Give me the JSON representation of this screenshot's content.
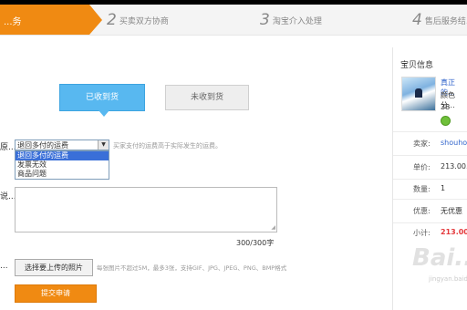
{
  "steps": {
    "active_label": "...务",
    "items": [
      {
        "num": "2",
        "label": "买卖双方协商"
      },
      {
        "num": "3",
        "label": "淘宝介入处理"
      },
      {
        "num": "4",
        "label": "售后服务结..."
      }
    ]
  },
  "receipt": {
    "received_label": "已收到货",
    "not_received_label": "未收到货"
  },
  "form": {
    "reason_label": "原...",
    "reason_selected": "退回多付的运费",
    "reason_options": [
      "退回多付的运费",
      "发票无效",
      "商品问题"
    ],
    "reason_hint": "买家支付的运费高于实际发生的运费。",
    "desc_label": "说...",
    "counter": "300/300字",
    "upload_label": "...",
    "upload_button": "选择要上传的照片",
    "upload_hint": "每张图片不超过5M，最多3张，支持GIF、JPG、JPEG、PNG、BMP格式",
    "submit_button": "提交申请"
  },
  "sidebar": {
    "title": "宝贝信息",
    "product_link": "真正的...",
    "product_color": "颜色分...",
    "product_size": "38",
    "rows": [
      {
        "key": "卖家:",
        "value": "shouho..."
      },
      {
        "key": "单价:",
        "value": "213.00..."
      },
      {
        "key": "数量:",
        "value": "1"
      },
      {
        "key": "优惠:",
        "value": "无优惠"
      },
      {
        "key": "小计:",
        "value": "213.00..."
      }
    ]
  },
  "watermark": {
    "text": "Bai...",
    "sub": "jingyan.baidu.com"
  },
  "colors": {
    "accent": "#f08a12",
    "blue": "#58b8f0",
    "link": "#3366cc",
    "price": "#e4393c"
  }
}
